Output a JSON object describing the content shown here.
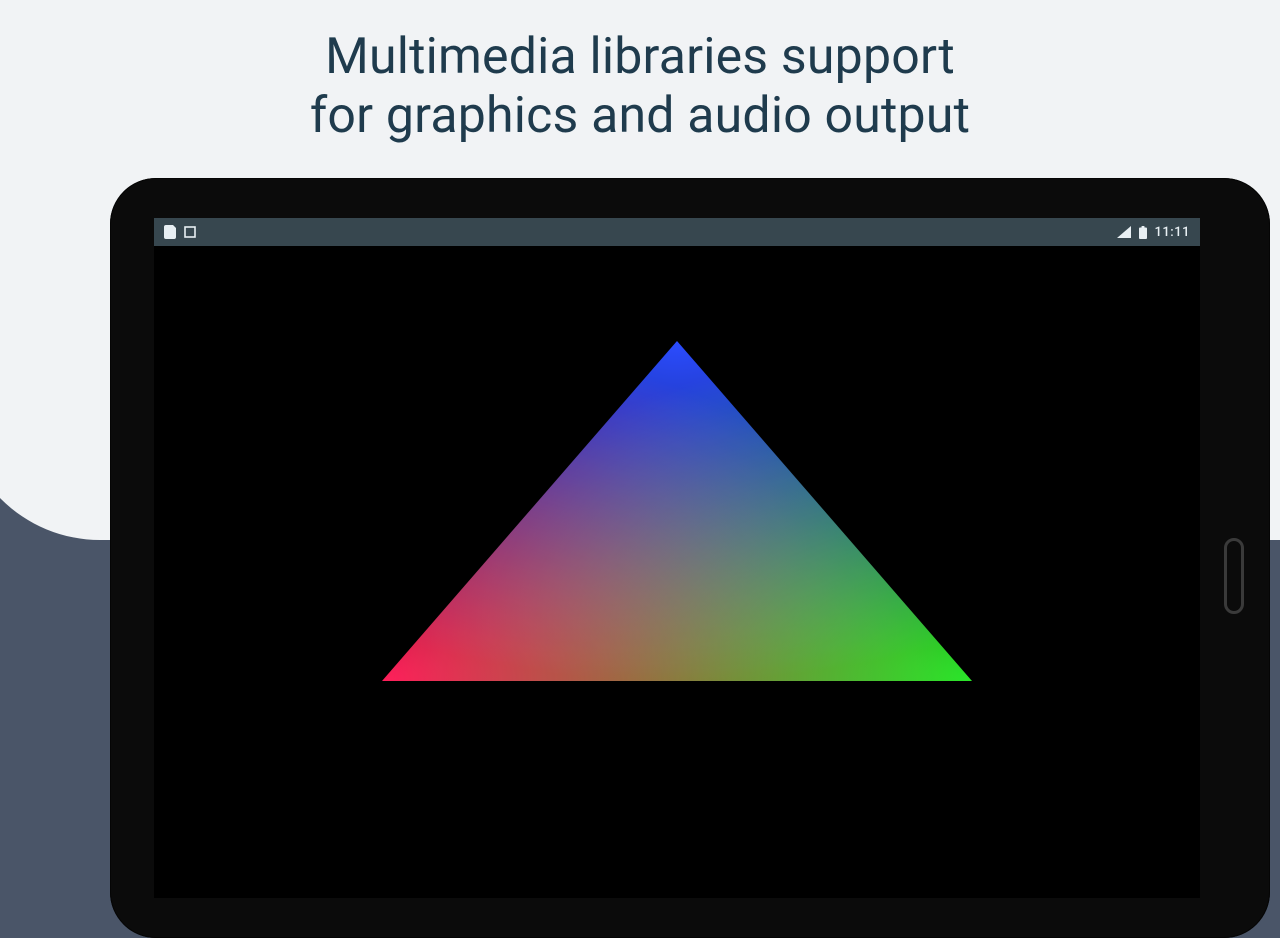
{
  "headline": {
    "line1": "Multimedia libraries support",
    "line2": "for graphics and audio output"
  },
  "statusbar": {
    "clock": "11:11"
  },
  "triangle": {
    "top_color": "#2b4cff",
    "left_color": "#ff1e5a",
    "right_color": "#29e629"
  },
  "colors": {
    "bg_dark": "#4a5568",
    "bg_light": "#f1f3f5",
    "headline": "#1f3b4d",
    "statusbar_bg": "#37474f",
    "tablet_frame": "#0b0b0b"
  }
}
